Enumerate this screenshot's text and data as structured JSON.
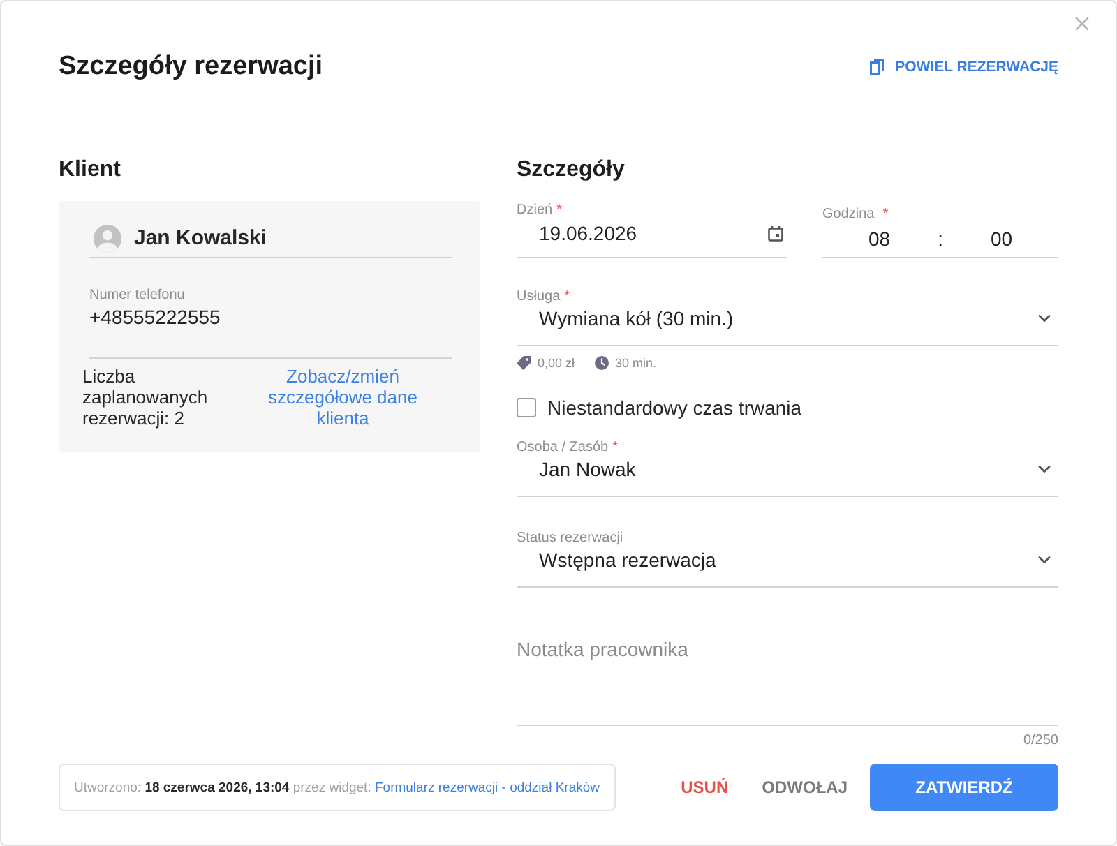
{
  "dialog": {
    "title": "Szczegóły rezerwacji",
    "duplicate_button": "POWIEL REZERWACJĘ"
  },
  "client": {
    "heading": "Klient",
    "name": "Jan Kowalski",
    "phone_label": "Numer telefonu",
    "phone": "+48555222555",
    "reservations_count": "Liczba zaplanowanych rezerwacji: 2",
    "details_link": "Zobacz/zmień szczegółowe dane klienta"
  },
  "details": {
    "heading": "Szczegóły",
    "date": {
      "label": "Dzień",
      "required_mark": "*",
      "value": "19.06.2026"
    },
    "time": {
      "label": "Godzina",
      "required_mark": "*",
      "hours": "08",
      "separator": ":",
      "minutes": "00"
    },
    "service": {
      "label": "Usługa",
      "required_mark": "*",
      "value": "Wymiana kół (30 min.)",
      "price": "0,00 zł",
      "duration": "30 min."
    },
    "custom_duration": {
      "label": "Niestandardowy czas trwania",
      "checked": false
    },
    "resource": {
      "label": "Osoba / Zasób",
      "required_mark": "*",
      "value": "Jan Nowak"
    },
    "status": {
      "label": "Status rezerwacji",
      "value": "Wstępna rezerwacja"
    },
    "note": {
      "placeholder": "Notatka pracownika",
      "counter": "0/250"
    }
  },
  "footer": {
    "created_info": "Utworzono: **18 czerwca 2026, 13:04** przez widget:",
    "widget_link": "Formularz rezerwacji - oddział Kraków",
    "buttons": [
      {
        "label": "USUŃ",
        "kind": "danger"
      },
      {
        "label": "ODWOŁAJ",
        "kind": "neutral"
      },
      {
        "label": "ZATWIERDŹ",
        "kind": "primary"
      }
    ]
  }
}
